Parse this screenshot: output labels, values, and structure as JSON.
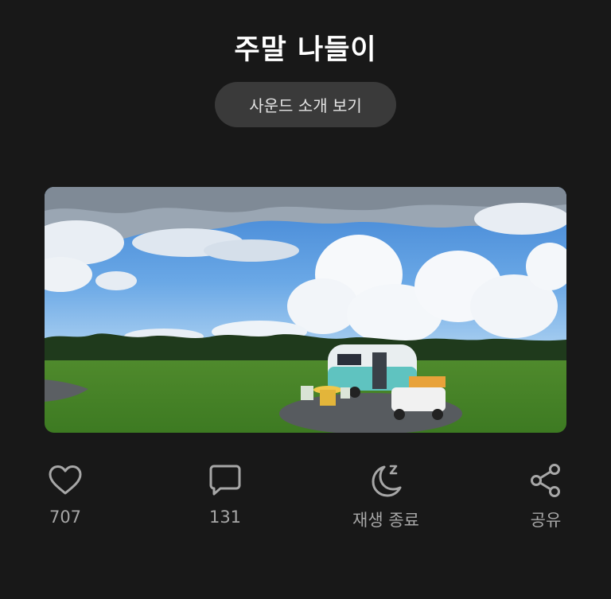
{
  "header": {
    "title": "주말 나들이",
    "sound_intro_label": "사운드 소개 보기"
  },
  "artwork": {
    "icon": "landscape-photo",
    "description_hidden": true
  },
  "actions": {
    "like": {
      "icon": "heart-icon",
      "count": "707"
    },
    "comment": {
      "icon": "speech-bubble-icon",
      "count": "131"
    },
    "sleep_timer": {
      "icon": "moon-icon",
      "label": "재생 종료"
    },
    "share": {
      "icon": "share-icon",
      "label": "공유"
    }
  },
  "colors": {
    "background": "#181818",
    "button_bg": "#3a3a3a",
    "icon_gray": "#a7a7a7"
  }
}
